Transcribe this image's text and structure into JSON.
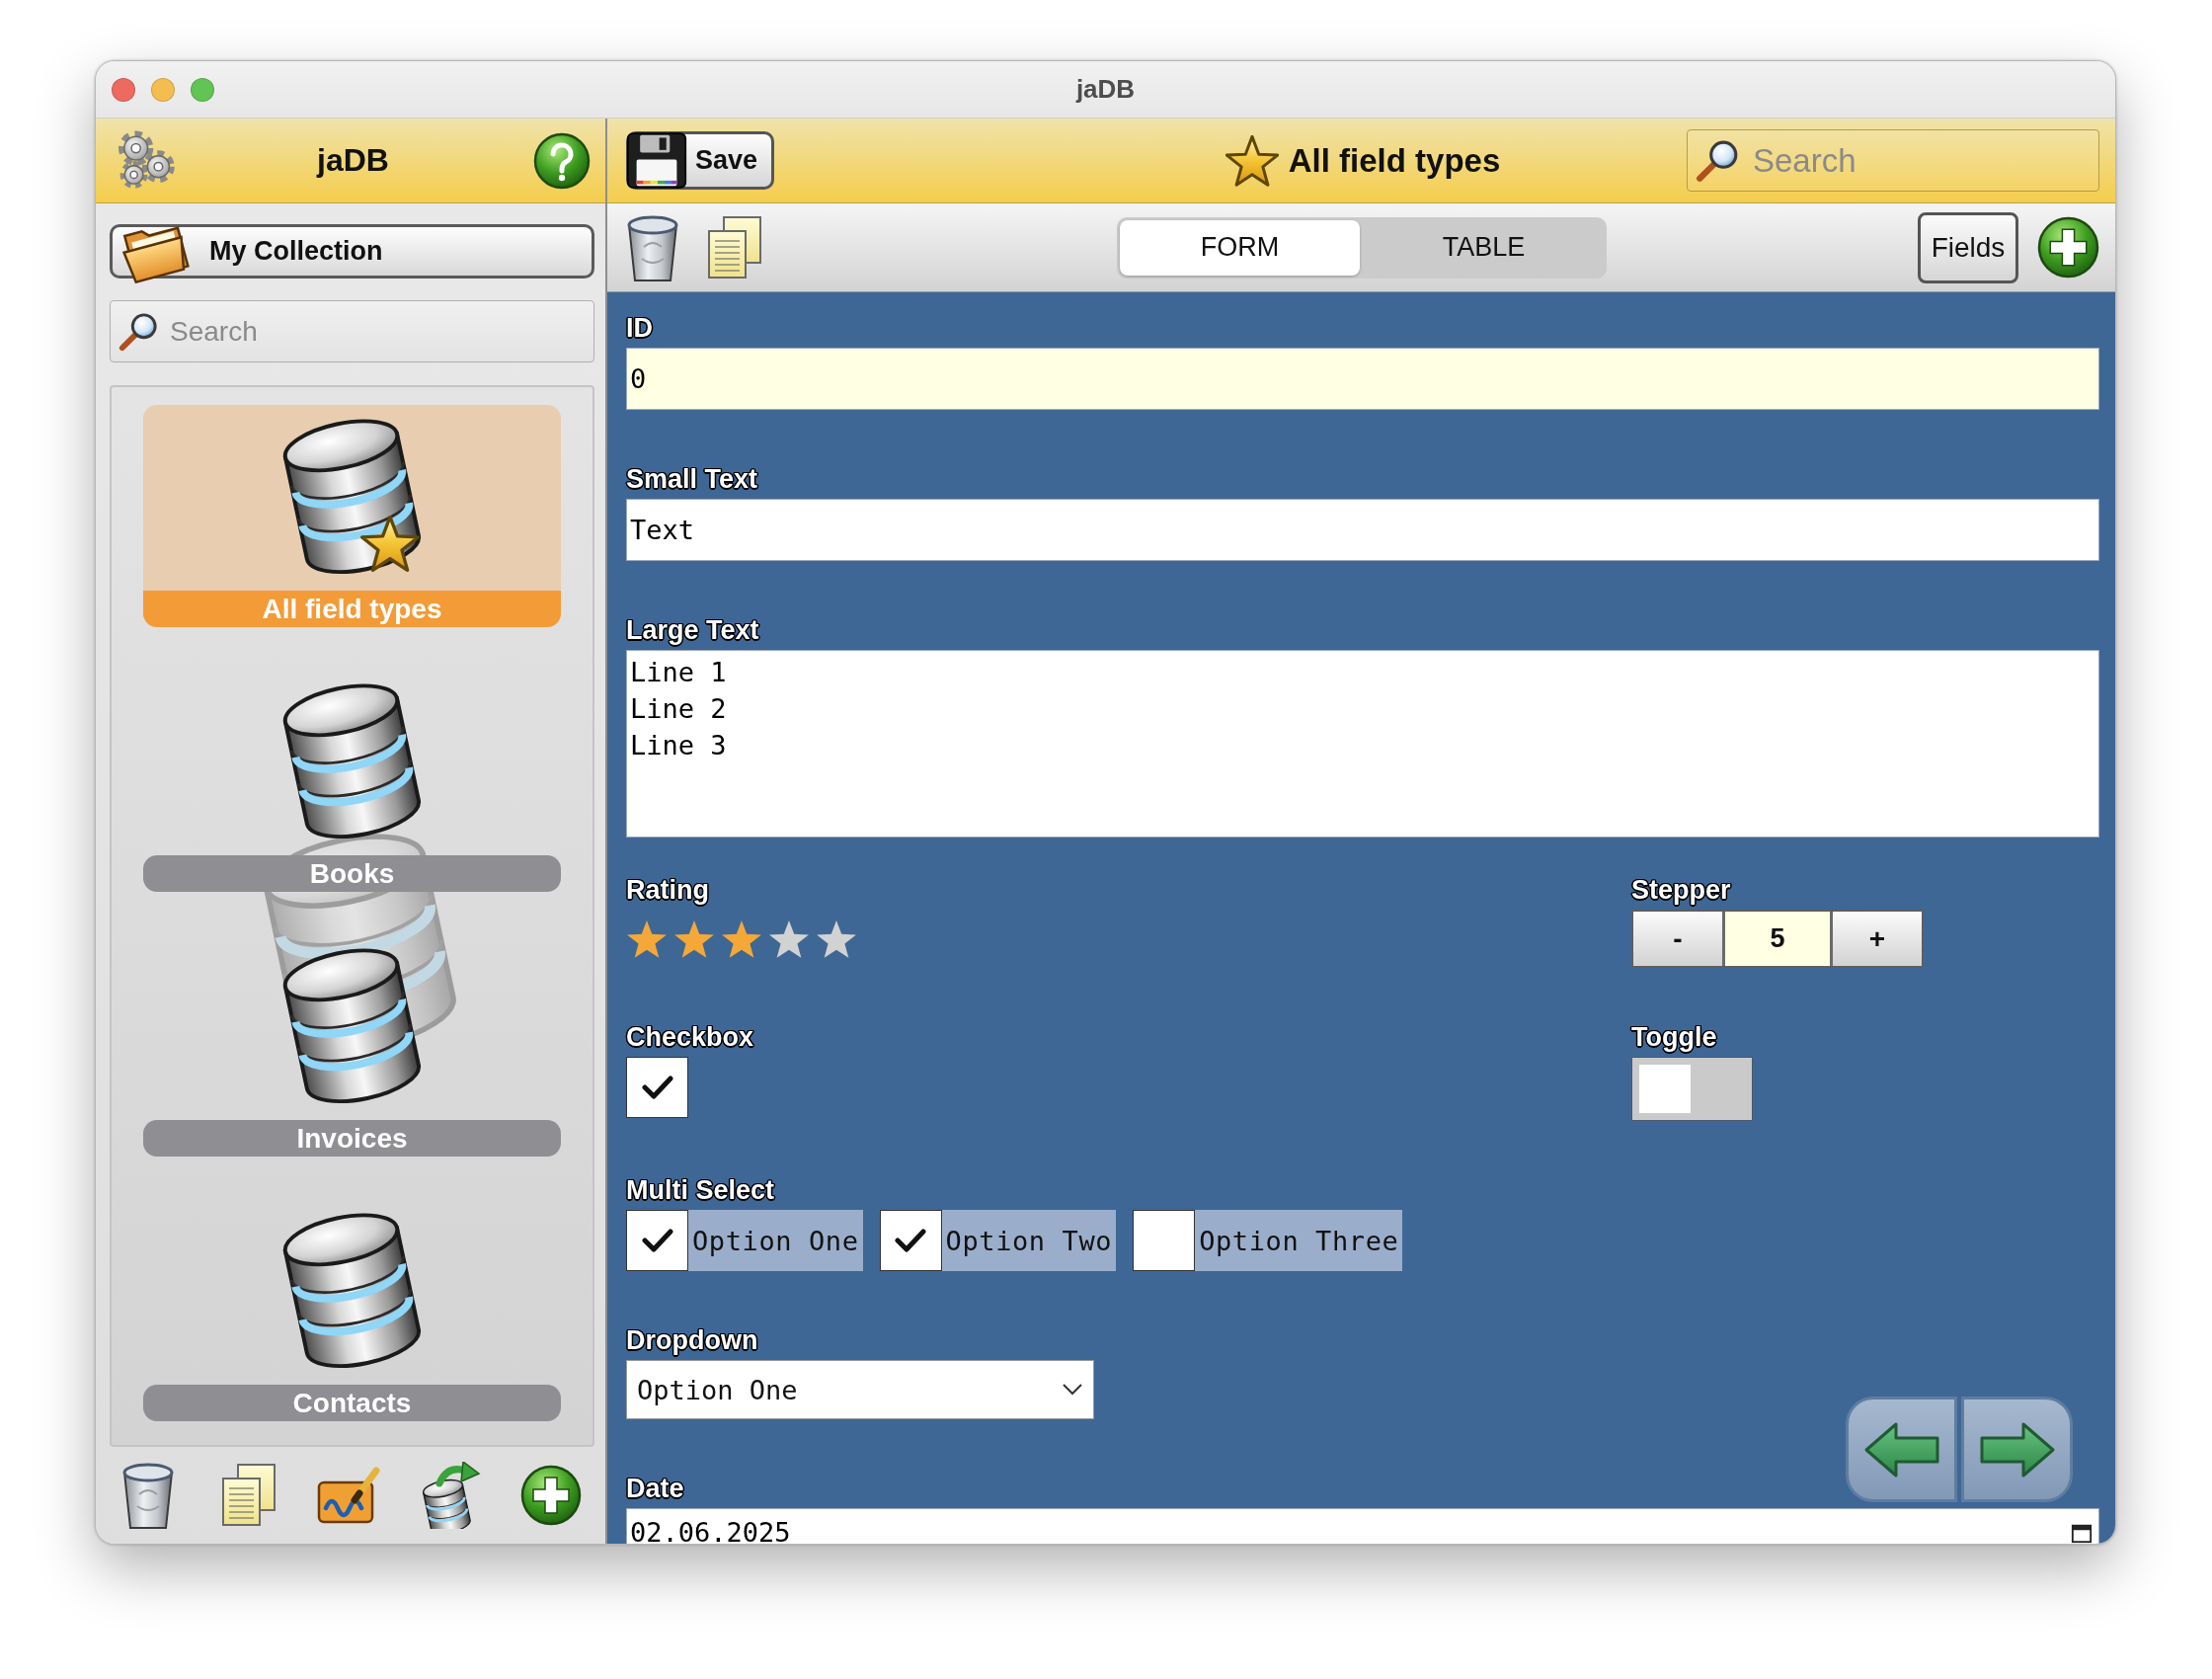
{
  "window": {
    "title": "jaDB"
  },
  "sidebar": {
    "title": "jaDB",
    "collection_button": {
      "label": "My Collection"
    },
    "search": {
      "placeholder": "Search"
    },
    "items": [
      {
        "label": "All field types",
        "selected": true,
        "starred": true
      },
      {
        "label": "Books",
        "selected": false,
        "starred": false
      },
      {
        "label": "Invoices",
        "selected": false,
        "starred": false
      },
      {
        "label": "Contacts",
        "selected": false,
        "starred": false
      }
    ]
  },
  "toolbar": {
    "save_button": {
      "label": "Save"
    },
    "title": "All field types",
    "search": {
      "placeholder": "Search"
    }
  },
  "view_tabs": [
    {
      "label": "FORM",
      "selected": true
    },
    {
      "label": "TABLE",
      "selected": false
    }
  ],
  "fields_button": {
    "label": "Fields"
  },
  "form": {
    "rows": [
      {
        "fields": [
          {
            "kind": "text",
            "label": "ID",
            "value": "0",
            "readonly": true
          }
        ]
      },
      {
        "fields": [
          {
            "kind": "text",
            "label": "Small Text",
            "value": "Text",
            "readonly": false
          }
        ]
      },
      {
        "fields": [
          {
            "kind": "textarea",
            "label": "Large Text",
            "value": "Line 1\nLine 2\nLine 3"
          }
        ]
      },
      {
        "fields": [
          {
            "kind": "rating",
            "label": "Rating",
            "stars": 3
          },
          {
            "kind": "stepper",
            "label": "Stepper",
            "value": "5",
            "decrement": "-",
            "increment": "+"
          }
        ]
      },
      {
        "fields": [
          {
            "kind": "checkbox",
            "label": "Checkbox",
            "checked": true
          },
          {
            "kind": "toggle",
            "label": "Toggle",
            "on": false
          }
        ]
      },
      {
        "fields": [
          {
            "kind": "multiselect",
            "label": "Multi Select",
            "options": [
              {
                "label": "Option One",
                "checked": true
              },
              {
                "label": "Option Two",
                "checked": true
              },
              {
                "label": "Option Three",
                "checked": false
              }
            ]
          }
        ]
      },
      {
        "fields": [
          {
            "kind": "dropdown",
            "label": "Dropdown",
            "value": "Option One"
          }
        ]
      },
      {
        "fields": [
          {
            "kind": "date",
            "label": "Date",
            "value": "02.06.2025"
          }
        ]
      }
    ]
  }
}
